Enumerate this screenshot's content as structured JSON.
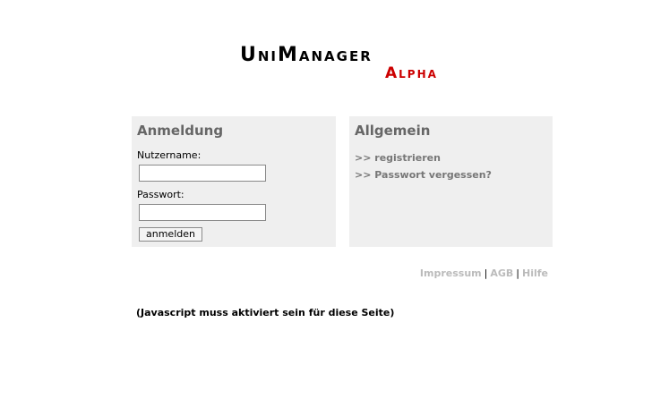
{
  "logo": {
    "title": "UniManager",
    "subtitle": "Alpha"
  },
  "login": {
    "heading": "Anmeldung",
    "username_label": "Nutzername:",
    "username_value": "",
    "password_label": "Passwort:",
    "password_value": "",
    "submit_label": "anmelden"
  },
  "general": {
    "heading": "Allgemein",
    "links": [
      ">> registrieren",
      ">> Passwort vergessen?"
    ]
  },
  "footer": {
    "links": [
      "Impressum",
      "AGB",
      "Hilfe"
    ],
    "separator": "|"
  },
  "notice": "(Javascript muss aktiviert sein für diese Seite)",
  "colors": {
    "panel_bg": "#efefef",
    "logo_accent": "#cc0000",
    "heading": "#666666",
    "link": "#777777",
    "footer_link": "#bbbbbb"
  }
}
